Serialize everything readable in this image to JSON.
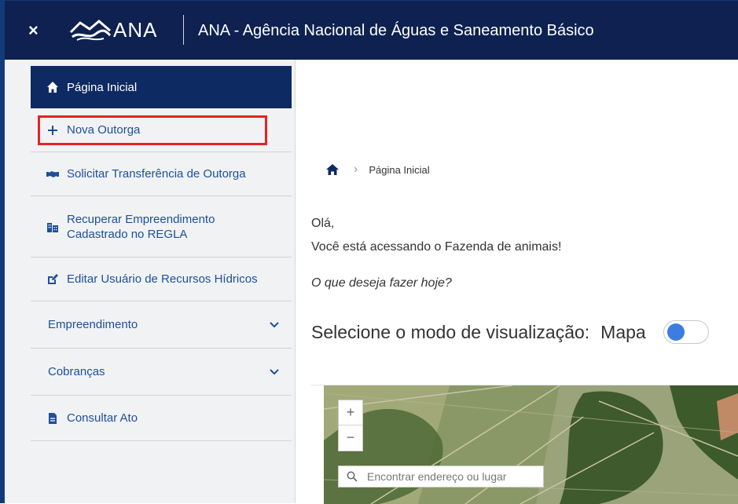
{
  "header": {
    "close_label": "×",
    "logo_text": "ANA",
    "title": "ANA - Agência Nacional de Águas e Saneamento Básico"
  },
  "sidebar": {
    "items": [
      {
        "label": "Página Inicial",
        "icon": "home-icon"
      },
      {
        "label": "Nova Outorga",
        "icon": "plus-icon"
      },
      {
        "label": "Solicitar Transferência de Outorga",
        "icon": "handshake-icon"
      },
      {
        "label": "Recuperar Empreendimento Cadastrado no REGLA",
        "icon": "buildings-icon"
      },
      {
        "label": "Editar Usuário de Recursos Hídricos",
        "icon": "edit-icon"
      },
      {
        "label": "Empreendimento",
        "icon": "chevron-down-icon"
      },
      {
        "label": "Cobranças",
        "icon": "chevron-down-icon"
      },
      {
        "label": "Consultar Ato",
        "icon": "document-icon"
      }
    ]
  },
  "breadcrumb": {
    "current": "Página Inicial"
  },
  "main": {
    "greeting": "Olá,",
    "access_message": "Você está acessando o Fazenda de animais!",
    "question": "O que deseja fazer hoje?",
    "viz_label": "Selecione o modo de visualização:",
    "viz_mode": "Mapa"
  },
  "map": {
    "zoom_in": "+",
    "zoom_out": "−",
    "search_placeholder": "Encontrar endereço ou lugar"
  },
  "colors": {
    "header_bg": "#0e2150",
    "active_nav_bg": "#0e2a63",
    "nav_text": "#1d4f9a",
    "highlight": "#e32424",
    "toggle_knob": "#3b7de0"
  }
}
